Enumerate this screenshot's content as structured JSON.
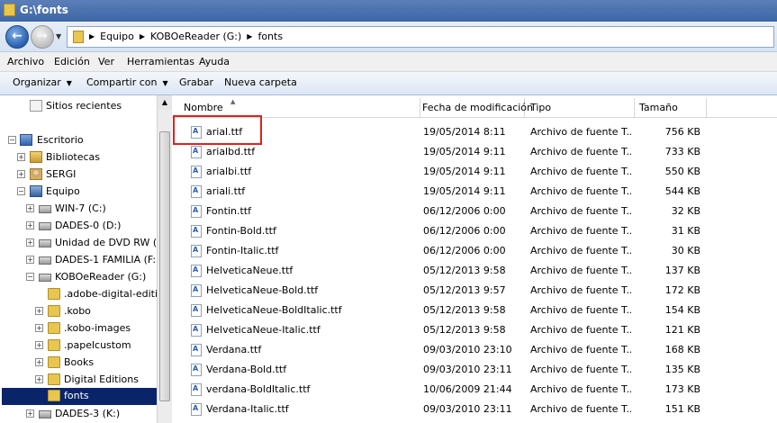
{
  "window": {
    "title": "G:\\fonts"
  },
  "address": {
    "crumbs": [
      "Equipo",
      "KOBOeReader (G:)",
      "fonts"
    ]
  },
  "menu": [
    "Archivo",
    "Edición",
    "Ver",
    "Herramientas",
    "Ayuda"
  ],
  "toolbar": {
    "organize": "Organizar",
    "share": "Compartir con",
    "burn": "Grabar",
    "new_folder": "Nueva carpeta"
  },
  "nav": {
    "items": [
      {
        "label": "Sitios recientes",
        "icon": "recent-places-icon"
      },
      {
        "label": "Escritorio",
        "icon": "desktop-icon"
      },
      {
        "label": "Bibliotecas",
        "icon": "libraries-icon"
      },
      {
        "label": "SERGI",
        "icon": "user-folder-icon"
      },
      {
        "label": "Equipo",
        "icon": "computer-icon"
      },
      {
        "label": "WIN-7 (C:)",
        "icon": "drive-icon"
      },
      {
        "label": "DADES-0 (D:)",
        "icon": "drive-icon"
      },
      {
        "label": "Unidad de DVD RW (E:)",
        "icon": "dvd-drive-icon"
      },
      {
        "label": "DADES-1 FAMILIA (F:)",
        "icon": "drive-icon"
      },
      {
        "label": "KOBOeReader (G:)",
        "icon": "drive-icon"
      },
      {
        "label": ".adobe-digital-editions",
        "icon": "folder-icon"
      },
      {
        "label": ".kobo",
        "icon": "folder-icon"
      },
      {
        "label": ".kobo-images",
        "icon": "folder-icon"
      },
      {
        "label": ".papelcustom",
        "icon": "folder-icon"
      },
      {
        "label": "Books",
        "icon": "folder-icon"
      },
      {
        "label": "Digital Editions",
        "icon": "folder-icon"
      },
      {
        "label": "fonts",
        "icon": "folder-icon",
        "selected": true
      },
      {
        "label": "DADES-3 (K:)",
        "icon": "drive-icon"
      }
    ]
  },
  "columns": {
    "name": "Nombre",
    "date": "Fecha de modificación",
    "type": "Tipo",
    "size": "Tamaño"
  },
  "files": [
    {
      "name": "arial.ttf",
      "date": "19/05/2014 8:11",
      "type": "Archivo de fuente T...",
      "size": "756 KB"
    },
    {
      "name": "arialbd.ttf",
      "date": "19/05/2014 9:11",
      "type": "Archivo de fuente T...",
      "size": "733 KB"
    },
    {
      "name": "arialbi.ttf",
      "date": "19/05/2014 9:11",
      "type": "Archivo de fuente T...",
      "size": "550 KB"
    },
    {
      "name": "ariali.ttf",
      "date": "19/05/2014 9:11",
      "type": "Archivo de fuente T...",
      "size": "544 KB"
    },
    {
      "name": "Fontin.ttf",
      "date": "06/12/2006 0:00",
      "type": "Archivo de fuente T...",
      "size": "32 KB"
    },
    {
      "name": "Fontin-Bold.ttf",
      "date": "06/12/2006 0:00",
      "type": "Archivo de fuente T...",
      "size": "31 KB"
    },
    {
      "name": "Fontin-Italic.ttf",
      "date": "06/12/2006 0:00",
      "type": "Archivo de fuente T...",
      "size": "30 KB"
    },
    {
      "name": "HelveticaNeue.ttf",
      "date": "05/12/2013 9:58",
      "type": "Archivo de fuente T...",
      "size": "137 KB"
    },
    {
      "name": "HelveticaNeue-Bold.ttf",
      "date": "05/12/2013 9:57",
      "type": "Archivo de fuente T...",
      "size": "172 KB"
    },
    {
      "name": "HelveticaNeue-BoldItalic.ttf",
      "date": "05/12/2013 9:58",
      "type": "Archivo de fuente T...",
      "size": "154 KB"
    },
    {
      "name": "HelveticaNeue-Italic.ttf",
      "date": "05/12/2013 9:58",
      "type": "Archivo de fuente T...",
      "size": "121 KB"
    },
    {
      "name": "Verdana.ttf",
      "date": "09/03/2010 23:10",
      "type": "Archivo de fuente T...",
      "size": "168 KB"
    },
    {
      "name": "Verdana-Bold.ttf",
      "date": "09/03/2010 23:11",
      "type": "Archivo de fuente T...",
      "size": "135 KB"
    },
    {
      "name": "verdana-BoldItalic.ttf",
      "date": "10/06/2009 21:44",
      "type": "Archivo de fuente T...",
      "size": "173 KB"
    },
    {
      "name": "Verdana-Italic.ttf",
      "date": "09/03/2010 23:11",
      "type": "Archivo de fuente T...",
      "size": "151 KB"
    }
  ]
}
